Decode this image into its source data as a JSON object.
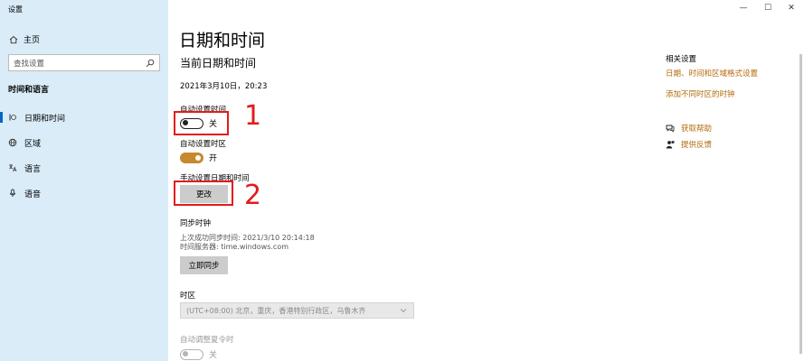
{
  "window": {
    "title": "设置",
    "minimize": "—",
    "maximize": "☐",
    "close": "✕"
  },
  "sidebar": {
    "home_label": "主页",
    "search_placeholder": "查找设置",
    "section_title": "时间和语言",
    "items": [
      {
        "label": "日期和时间",
        "icon": "clock-icon"
      },
      {
        "label": "区域",
        "icon": "globe-icon"
      },
      {
        "label": "语言",
        "icon": "language-icon"
      },
      {
        "label": "语音",
        "icon": "microphone-icon"
      }
    ]
  },
  "main": {
    "title": "日期和时间",
    "subtitle": "当前日期和时间",
    "current_datetime": "2021年3月10日，20:23",
    "auto_time": {
      "label": "自动设置时间",
      "state": "关"
    },
    "auto_zone": {
      "label": "自动设置时区",
      "state": "开"
    },
    "manual": {
      "label": "手动设置日期和时间",
      "button": "更改"
    },
    "sync": {
      "title": "同步时钟",
      "last_sync": "上次成功同步时间: 2021/3/10 20:14:18",
      "server": "时间服务器: time.windows.com",
      "button": "立即同步"
    },
    "timezone": {
      "label": "时区",
      "value": "(UTC+08:00) 北京，重庆，香港特别行政区，乌鲁木齐"
    },
    "dst": {
      "label": "自动调整夏令时",
      "state": "关"
    }
  },
  "annotations": {
    "num1": "1",
    "num2": "2",
    "color": "#e31b1b"
  },
  "related": {
    "title": "相关设置",
    "links": [
      "日期、时间和区域格式设置",
      "添加不同时区的时钟"
    ],
    "help": "获取帮助",
    "feedback": "提供反馈"
  },
  "colors": {
    "sidebar_bg": "#d9ecf8",
    "accent": "#c6892d",
    "link": "#b26a0a"
  }
}
